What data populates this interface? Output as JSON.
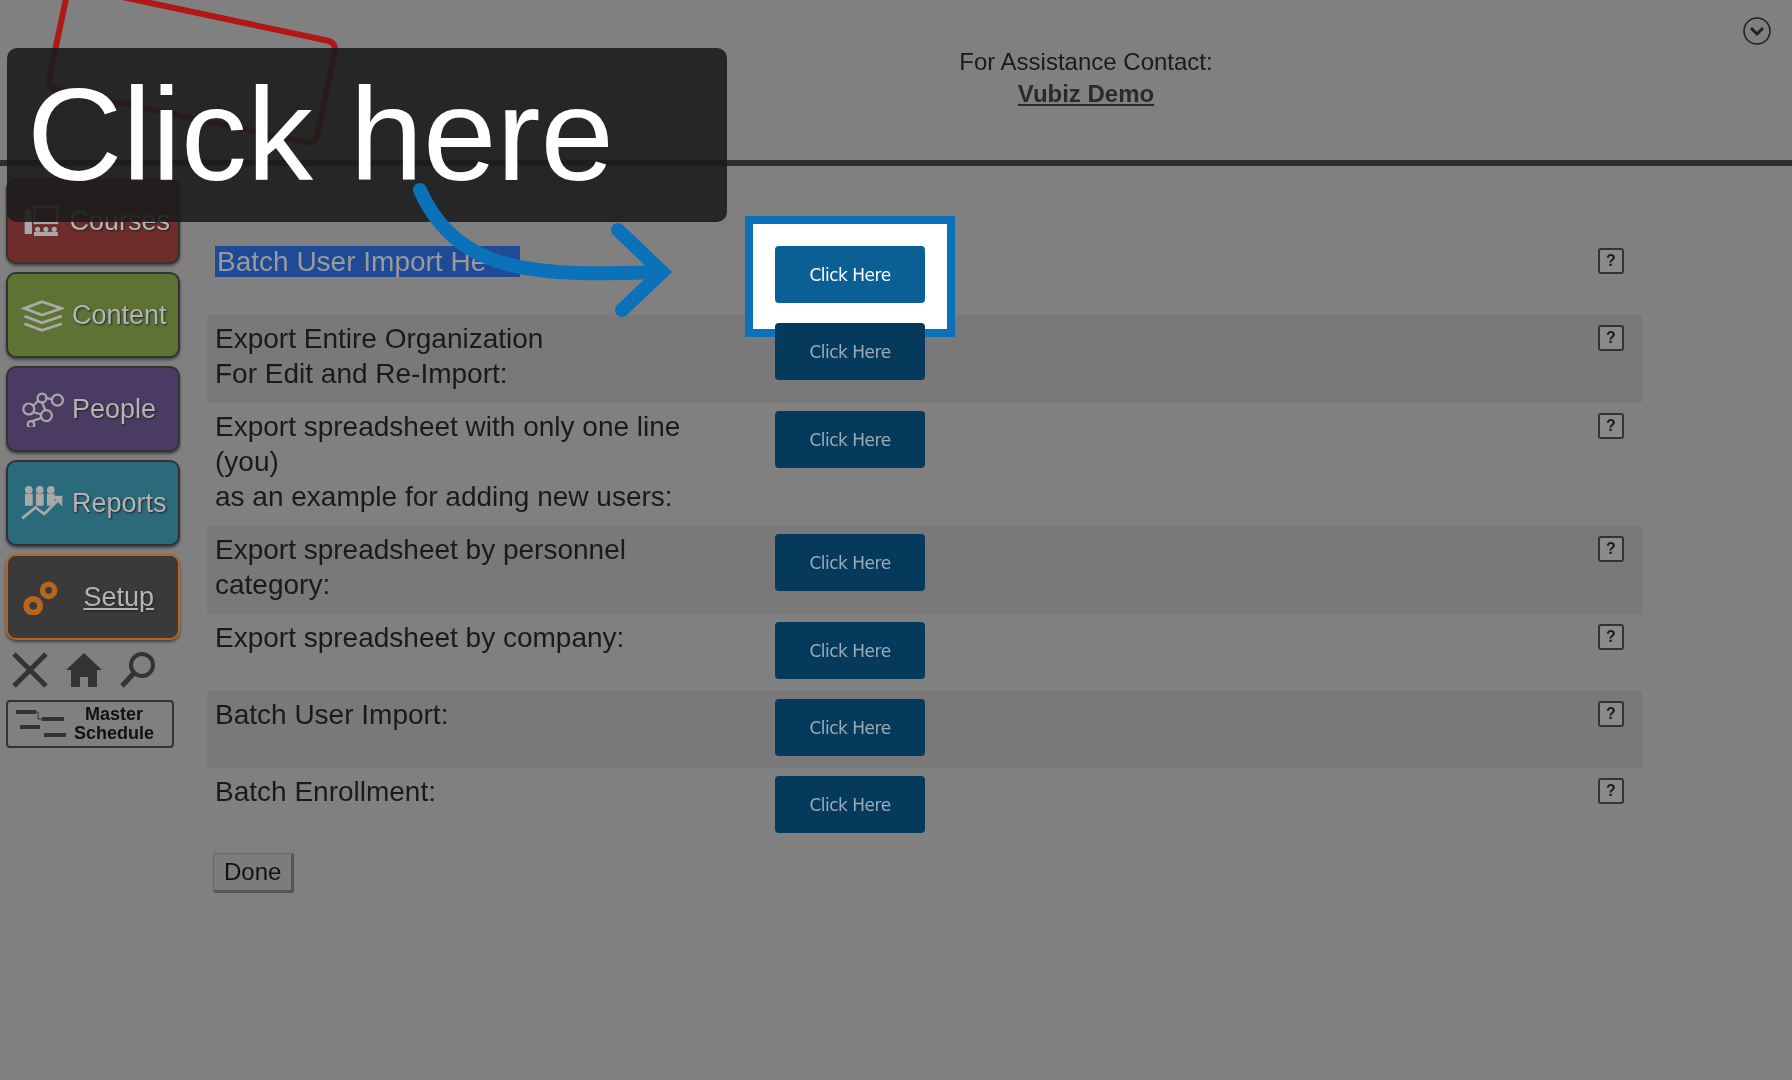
{
  "contact": {
    "label": "For Assistance Contact:",
    "name": "Vubiz Demo"
  },
  "sidebar": {
    "items": [
      {
        "label": "Courses",
        "kind": "courses",
        "color": "#6e2c2a",
        "selected": false
      },
      {
        "label": "Content",
        "kind": "content",
        "color": "#5d7334",
        "selected": false
      },
      {
        "label": "People",
        "kind": "people",
        "color": "#4a3b62",
        "selected": false
      },
      {
        "label": "Reports",
        "kind": "reports",
        "color": "#2b6a7b",
        "selected": false
      },
      {
        "label": "Setup",
        "kind": "setup",
        "color": "#3b3a3a",
        "selected": true
      }
    ],
    "master_schedule": [
      "Master",
      "Schedule"
    ]
  },
  "rows": [
    {
      "lines": [
        "Batch User Import He"
      ],
      "button": "Click Here",
      "help": "?",
      "shaded": false,
      "highlighted": true,
      "spotlit": true
    },
    {
      "lines": [
        "Export Entire Organization",
        "For Edit and Re-Import:"
      ],
      "button": "Click Here",
      "help": "?",
      "shaded": true,
      "highlighted": false,
      "spotlit": false
    },
    {
      "lines": [
        "Export spreadsheet with only one line",
        "(you)",
        "as an example for adding new users:"
      ],
      "button": "Click Here",
      "help": "?",
      "shaded": false,
      "highlighted": false,
      "spotlit": false
    },
    {
      "lines": [
        "Export spreadsheet by personnel",
        "category:"
      ],
      "button": "Click Here",
      "help": "?",
      "shaded": true,
      "highlighted": false,
      "spotlit": false
    },
    {
      "lines": [
        "Export spreadsheet by company:"
      ],
      "button": "Click Here",
      "help": "?",
      "shaded": false,
      "highlighted": false,
      "spotlit": false
    },
    {
      "lines": [
        "Batch User Import:"
      ],
      "button": "Click Here",
      "help": "?",
      "shaded": true,
      "highlighted": false,
      "spotlit": false
    },
    {
      "lines": [
        "Batch Enrollment:"
      ],
      "button": "Click Here",
      "help": "?",
      "shaded": false,
      "highlighted": false,
      "spotlit": false
    }
  ],
  "done": "Done",
  "callout": {
    "text": "Click here"
  }
}
